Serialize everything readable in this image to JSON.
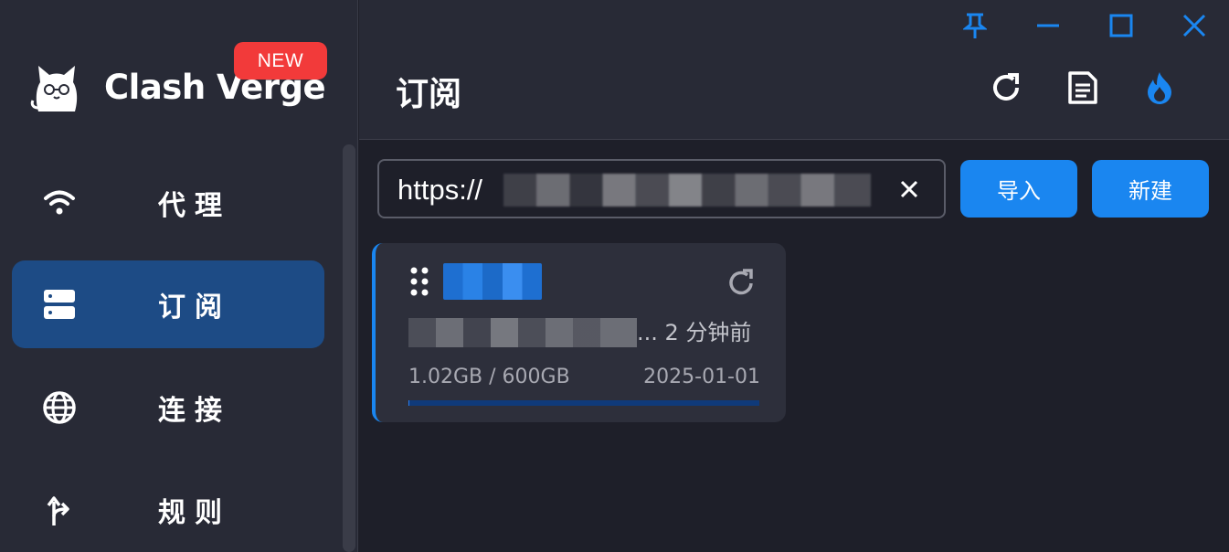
{
  "sidebar": {
    "brand": "Clash Verge",
    "badge": "NEW",
    "items": [
      {
        "label": "代理",
        "icon": "wifi-icon"
      },
      {
        "label": "订阅",
        "icon": "server-icon"
      },
      {
        "label": "连接",
        "icon": "globe-icon"
      },
      {
        "label": "规则",
        "icon": "fork-icon"
      }
    ],
    "active_index": 1
  },
  "header": {
    "title": "订阅",
    "buttons": [
      "refresh-icon",
      "log-icon",
      "fire-icon"
    ],
    "window_controls": [
      "pin-icon",
      "minimize-icon",
      "maximize-icon",
      "close-icon"
    ]
  },
  "toolbar": {
    "url_value": "https://",
    "import_label": "导入",
    "new_label": "新建"
  },
  "profile": {
    "updated": "... 2 分钟前",
    "usage": "1.02GB / 600GB",
    "expire": "2025-01-01",
    "usage_fraction": 0.0017
  },
  "colors": {
    "accent": "#1a86f0",
    "active_nav": "#1d4b85",
    "badge": "#f23a3a",
    "sidebar_bg": "#282a36",
    "main_bg": "#1e1f29"
  }
}
